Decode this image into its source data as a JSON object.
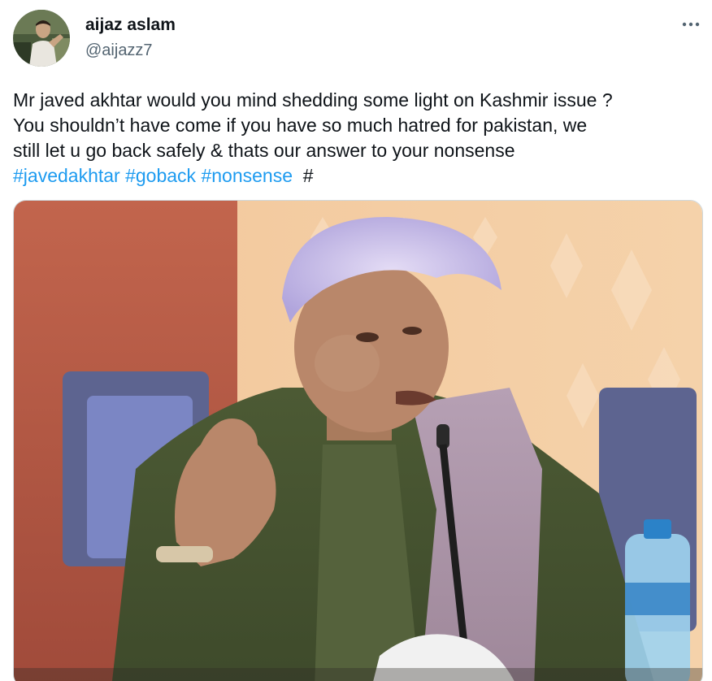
{
  "user": {
    "display_name": "aijaz aslam",
    "handle": "@aijazz7"
  },
  "more_icon": "ellipsis-horizontal-icon",
  "tweet": {
    "line1": "Mr javed akhtar would you mind shedding some light on Kashmir issue ?",
    "line2": "You shouldn’t have come if you have so much hatred for pakistan, we",
    "line3": "still let u go back safely & thats our answer to your nonsense",
    "hashtags": [
      "#javedakhtar",
      "#goback",
      "#nonsense"
    ],
    "trailing": "#"
  },
  "colors": {
    "text": "#0f1419",
    "secondary": "#536471",
    "link": "#1d9bf0",
    "border": "#cfd9de"
  }
}
